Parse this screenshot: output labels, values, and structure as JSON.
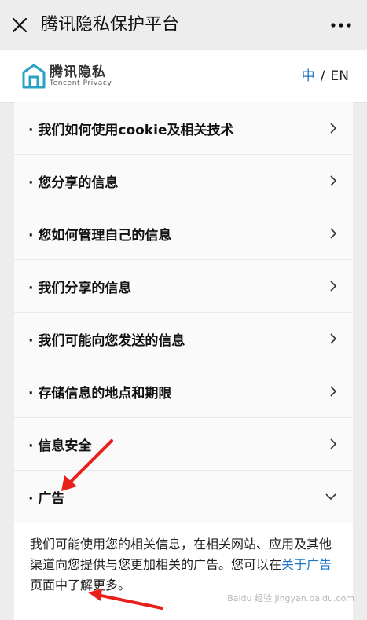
{
  "topbar": {
    "title": "腾讯隐私保护平台",
    "close_icon": "close-icon",
    "more_icon": "more-icon"
  },
  "header": {
    "logo_cn": "腾讯隐私",
    "logo_en": "Tencent Privacy",
    "lang_zh": "中",
    "lang_sep": "/",
    "lang_en": "EN"
  },
  "menu": {
    "items": [
      {
        "label": "· 我们如何使用cookie及相关技术"
      },
      {
        "label": "· 您分享的信息"
      },
      {
        "label": "· 您如何管理自己的信息"
      },
      {
        "label": "· 我们分享的信息"
      },
      {
        "label": "· 我们可能向您发送的信息"
      },
      {
        "label": "· 存储信息的地点和期限"
      },
      {
        "label": "· 信息安全"
      },
      {
        "label": "· 广告"
      }
    ]
  },
  "description": {
    "part1": "我们可能使用您的相关信息，在相关网站、应用及其他渠道向您提供与您更加相关的广告。您可以在",
    "link": "关于广告",
    "part2": "页面中了解更多。"
  },
  "watermark": "Baidu 经验 jingyan.baidu.com",
  "colors": {
    "accent": "#1e76c5",
    "annotation_arrow": "#e8201c"
  }
}
